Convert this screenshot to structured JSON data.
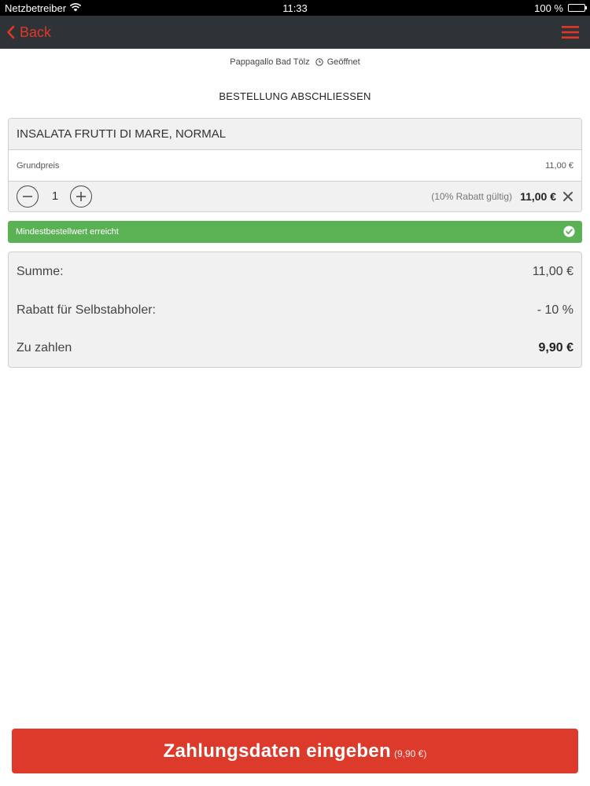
{
  "status_bar": {
    "carrier": "Netzbetreiber",
    "time": "11:33",
    "battery": "100 %"
  },
  "nav": {
    "back_label": "Back",
    "accent_color": "#e53528",
    "bar_color": "#2e3337"
  },
  "shop": {
    "name": "Pappagallo Bad Tölz",
    "status": "Geöffnet"
  },
  "page_title": "BESTELLUNG ABSCHLIESSEN",
  "cart": {
    "item_name": "INSALATA FRUTTI DI MARE, NORMAL",
    "base_price_label": "Grundpreis",
    "base_price": "11,00 €",
    "quantity": "1",
    "discount_note": "(10% Rabatt gültig)",
    "line_total": "11,00 €"
  },
  "min_order": {
    "text": "Mindestbestellwert erreicht",
    "color": "#5bb255"
  },
  "summary": {
    "sum_label": "Summe:",
    "sum_value": "11,00 €",
    "discount_label": "Rabatt für Selbstabholer:",
    "discount_value": "- 10 %",
    "total_label": "Zu zahlen",
    "total_value": "9,90 €"
  },
  "pay_button": {
    "label": "Zahlungsdaten eingeben",
    "amount": "(9,90 €)",
    "color": "#dc3a2b"
  }
}
